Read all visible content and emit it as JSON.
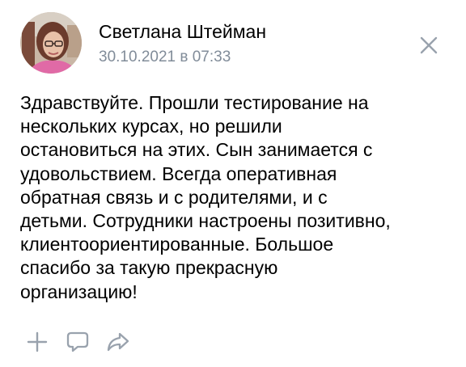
{
  "post": {
    "author": "Светлана Штейман",
    "date": "30.10.2021 в 07:33",
    "text_lines": [
      "Здравствуйте. Прошли тестирование на",
      "нескольких курсах, но решили",
      "остановиться на этих. Сын занимается с",
      "удовольствием. Всегда оперативная",
      "обратная связь и с родителями, и с",
      "детьми. Сотрудники настроены позитивно,",
      "клиентоориентированные. Большое",
      "спасибо за такую прекрасную",
      "организацию!"
    ]
  },
  "icons": {
    "close": "close-icon",
    "like": "plus-icon",
    "comment": "comment-icon",
    "share": "share-icon"
  },
  "colors": {
    "text": "#000000",
    "secondary": "#818c99",
    "icon": "#99a2ad"
  }
}
